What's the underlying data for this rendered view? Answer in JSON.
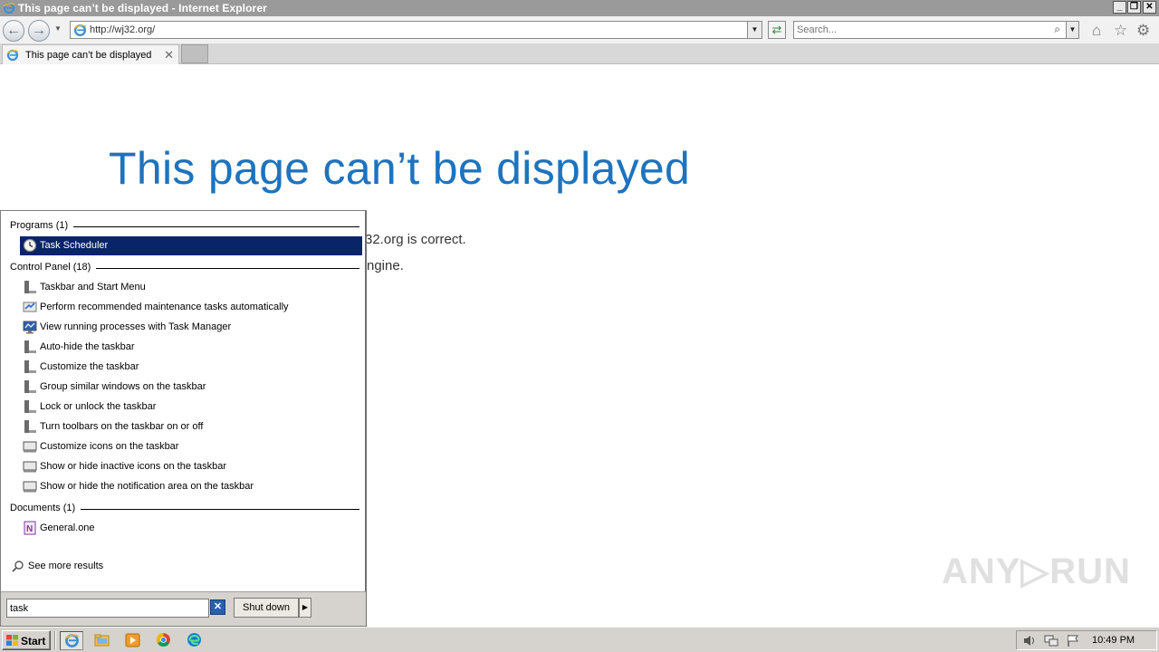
{
  "window": {
    "title": "This page can’t be displayed - Internet Explorer",
    "controls": {
      "minimize": "_",
      "restore": "❐",
      "close": "✕"
    }
  },
  "navbar": {
    "back_icon": "←",
    "forward_icon": "→",
    "url": "http://wj32.org/",
    "dropdown_icon": "▼",
    "refresh_icon": "⇄",
    "search_placeholder": "Search...",
    "search_icon": "⌕",
    "tools": {
      "home": "⌂",
      "favorites": "☆",
      "settings": "⚙"
    }
  },
  "tabs": [
    {
      "label": "This page can’t be displayed",
      "close": "✕"
    }
  ],
  "page": {
    "heading": "This page can’t be displayed",
    "line1_visible": "32.org is correct.",
    "line2_visible": "ngine."
  },
  "start_menu": {
    "programs": {
      "label": "Programs (1)",
      "items": [
        {
          "label": "Task Scheduler",
          "icon": "clock-icon",
          "selected": true
        }
      ]
    },
    "control_panel": {
      "label": "Control Panel (18)",
      "items": [
        {
          "label": "Taskbar and Start Menu",
          "icon": "taskbar-icon"
        },
        {
          "label": "Perform recommended maintenance tasks automatically",
          "icon": "maintenance-icon"
        },
        {
          "label": "View running processes with Task Manager",
          "icon": "monitor-icon"
        },
        {
          "label": "Auto-hide the taskbar",
          "icon": "taskbar-icon"
        },
        {
          "label": "Customize the taskbar",
          "icon": "taskbar-icon"
        },
        {
          "label": "Group similar windows on the taskbar",
          "icon": "taskbar-icon"
        },
        {
          "label": "Lock or unlock the taskbar",
          "icon": "taskbar-icon"
        },
        {
          "label": "Turn toolbars on the taskbar on or off",
          "icon": "taskbar-icon"
        },
        {
          "label": "Customize icons on the taskbar",
          "icon": "notification-icon"
        },
        {
          "label": "Show or hide inactive icons on the taskbar",
          "icon": "notification-icon"
        },
        {
          "label": "Show or hide the notification area on the taskbar",
          "icon": "notification-icon"
        }
      ]
    },
    "documents": {
      "label": "Documents (1)",
      "items": [
        {
          "label": "General.one",
          "icon": "onenote-icon"
        }
      ]
    },
    "see_more": "See more results",
    "search_value": "task",
    "clear_icon": "✕",
    "shutdown_label": "Shut down",
    "shutdown_arrow": "▶"
  },
  "taskbar": {
    "start_label": "Start",
    "pinned": [
      "internet-explorer-icon",
      "explorer-folder-icon",
      "media-player-icon",
      "chrome-icon",
      "edge-icon"
    ],
    "clock": "10:49 PM"
  },
  "watermark": {
    "text": "ANY▷RUN"
  },
  "colors": {
    "accent_blue": "#1e73be",
    "selection_navy": "#0a246a",
    "titlebar_gray": "#9a9a9a",
    "taskbar_gray": "#d6d3ce"
  }
}
